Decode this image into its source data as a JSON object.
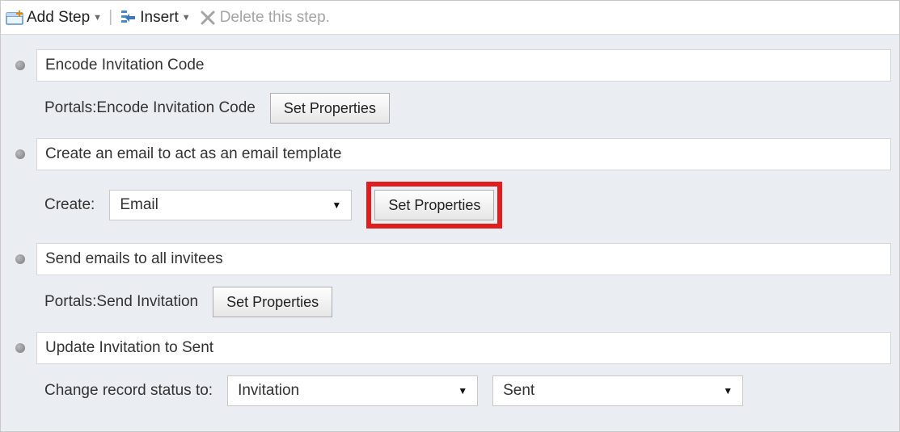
{
  "toolbar": {
    "add_step_label": "Add Step",
    "insert_label": "Insert",
    "delete_label": "Delete this step."
  },
  "steps": [
    {
      "title": "Encode Invitation Code",
      "config": {
        "prefix_label": "Portals:Encode Invitation Code",
        "set_properties_label": "Set Properties"
      }
    },
    {
      "title": "Create an email to act as an email template",
      "config": {
        "create_label": "Create:",
        "create_select_value": "Email",
        "set_properties_label": "Set Properties"
      }
    },
    {
      "title": "Send emails to all invitees",
      "config": {
        "prefix_label": "Portals:Send Invitation",
        "set_properties_label": "Set Properties"
      }
    },
    {
      "title": "Update Invitation to Sent",
      "config": {
        "change_status_label": "Change record status to:",
        "status_entity_value": "Invitation",
        "status_value_value": "Sent"
      }
    }
  ]
}
